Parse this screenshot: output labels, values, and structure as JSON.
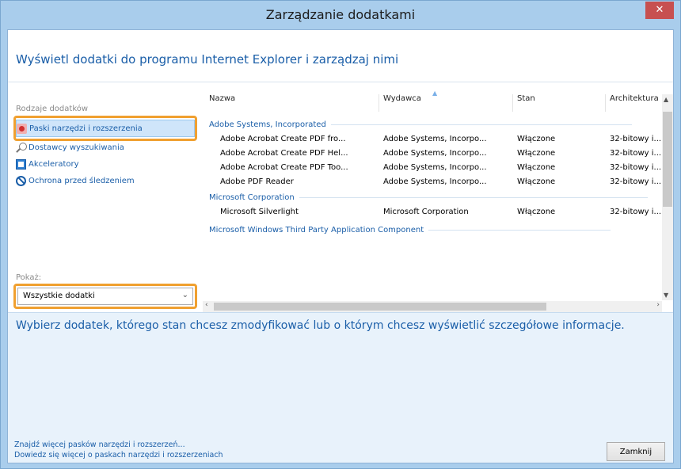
{
  "window": {
    "title": "Zarządzanie dodatkami",
    "close_glyph": "✕"
  },
  "header": {
    "text": "Wyświetl dodatki do programu Internet Explorer i zarządzaj nimi"
  },
  "sidebar": {
    "types_label": "Rodzaje dodatków",
    "items": [
      {
        "label": "Paski narzędzi i rozszerzenia",
        "icon": "toolbar-icon",
        "selected": true
      },
      {
        "label": "Dostawcy wyszukiwania",
        "icon": "search-icon",
        "selected": false
      },
      {
        "label": "Akceleratory",
        "icon": "accelerator-icon",
        "selected": false
      },
      {
        "label": "Ochrona przed śledzeniem",
        "icon": "tracking-protection-icon",
        "selected": false
      }
    ],
    "show_label": "Pokaż:",
    "show_value": "Wszystkie dodatki"
  },
  "list": {
    "columns": [
      "Nazwa",
      "Wydawca",
      "Stan",
      "Architektura"
    ],
    "groups": [
      {
        "name": "Adobe Systems, Incorporated",
        "rows": [
          [
            "Adobe Acrobat Create PDF fro...",
            "Adobe Systems, Incorpo...",
            "Włączone",
            "32-bitowy i..."
          ],
          [
            "Adobe Acrobat Create PDF Hel...",
            "Adobe Systems, Incorpo...",
            "Włączone",
            "32-bitowy i..."
          ],
          [
            "Adobe Acrobat Create PDF Too...",
            "Adobe Systems, Incorpo...",
            "Włączone",
            "32-bitowy i..."
          ],
          [
            "Adobe PDF Reader",
            "Adobe Systems, Incorpo...",
            "Włączone",
            "32-bitowy i..."
          ]
        ]
      },
      {
        "name": "Microsoft Corporation",
        "rows": [
          [
            "Microsoft Silverlight",
            "Microsoft Corporation",
            "Włączone",
            "32-bitowy i..."
          ]
        ]
      },
      {
        "name": "Microsoft Windows Third Party Application Component",
        "rows": []
      }
    ]
  },
  "details": {
    "text": "Wybierz dodatek, którego stan chcesz zmodyfikować lub o którym chcesz wyświetlić szczegółowe informacje."
  },
  "footer": {
    "link1": "Znajdź więcej pasków narzędzi i rozszerzeń...",
    "link2": "Dowiedz się więcej o paskach narzędzi i rozszerzeniach",
    "close_button": "Zamknij"
  },
  "colors": {
    "accent": "#1a5ea8",
    "highlight": "#f0a030",
    "titlebar": "#a9cdec"
  }
}
